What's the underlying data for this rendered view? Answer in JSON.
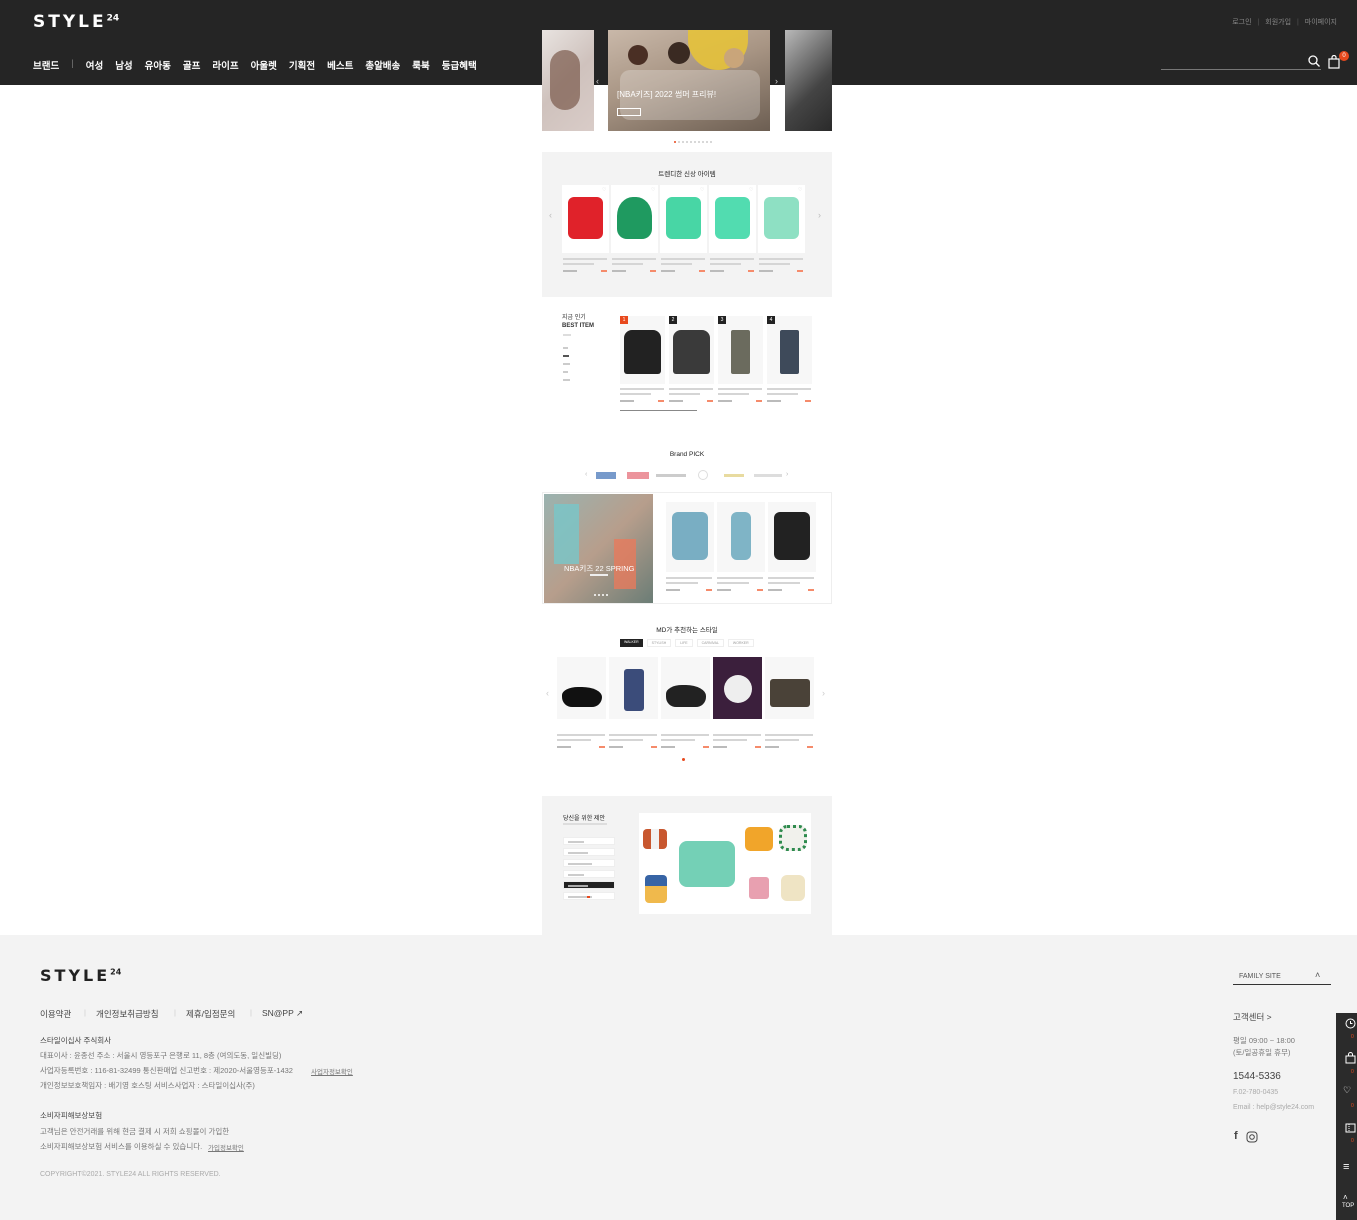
{
  "header": {
    "logo": "STYLE",
    "logo_sup": "24",
    "util_links": [
      "로그인",
      "회원가입",
      "마이페이지"
    ],
    "nav": [
      "브랜드",
      "여성",
      "남성",
      "유아동",
      "골프",
      "라이프",
      "아울렛",
      "기획전",
      "베스트",
      "총알배송",
      "룩북",
      "등급혜택"
    ],
    "cart_count": "0"
  },
  "hero": {
    "title": "[NBA키즈] 2022 썸머 프리뷰!",
    "dots_total": 10,
    "dots_active": 1
  },
  "trend": {
    "title": "트렌디한 신상 아이템",
    "items": [
      {
        "name": "red-polo",
        "color": "#e0222a"
      },
      {
        "name": "green-bucket-hat",
        "color": "#1f9a60"
      },
      {
        "name": "mint-tshirt",
        "color": "#48d6a5"
      },
      {
        "name": "mint-tshirt-2",
        "color": "#52dcb0"
      },
      {
        "name": "striped-tshirt",
        "color": "#8ee0c3"
      }
    ]
  },
  "best": {
    "title_1": "지금 인기",
    "title_2": "BEST ITEM",
    "badges": [
      "1",
      "2",
      "3",
      "4"
    ]
  },
  "brand_pick": {
    "title": "Brand PICK",
    "promo_title": "NBA키즈 22 SPRING"
  },
  "md": {
    "title": "MD가 추천하는 스타일",
    "tabs": [
      "WALKER",
      "STYLISH",
      "LIFE",
      "CARNIVAL",
      "WORKER"
    ]
  },
  "parent": {
    "title": "당신을 위한 제안"
  },
  "footer": {
    "logo": "STYLE",
    "logo_sup": "24",
    "links": [
      "이용약관",
      "개인정보취급방침",
      "제휴/입점문의",
      "SN@PP"
    ],
    "company": "스타일이십사 주식회사",
    "line1": "대표이사 : 윤종선    주소 : 서울시 영등포구 은행로 11, 8층 (여의도동, 일신빌딩)",
    "line2": "사업자등록번호 : 116-81-32499    통신판매업 신고번호 : 제2020-서울영등포-1432",
    "biz_check": "사업자정보확인",
    "line3": "개인정보보호책임자 : 배기영    호스팅 서비스사업자 : 스타일이십사(주)",
    "guarantee_title": "소비자피해보상보험",
    "guarantee_1": "고객님은 안전거래를 위해 현금 결제 시 저희 쇼핑몰이 가입한",
    "guarantee_2": "소비자피해보상보험 서비스를 이용하실 수 있습니다.",
    "guarantee_link": "가입정보확인",
    "copyright": "COPYRIGHT©2021. STYLE24 ALL RIGHTS RESERVED.",
    "family_site": "FAMILY SITE",
    "cs_title": "고객센터 >",
    "cs_hours_1": "평일 09:00 ~ 18:00",
    "cs_hours_2": "(토/일공휴일 휴무)",
    "cs_phone": "1544-5336",
    "cs_fax": "F.02-780-0435",
    "cs_email": "Email : help@style24.com"
  },
  "quickbar": {
    "recent_count": "0",
    "cart_count": "0",
    "wish_count": "0",
    "coupon_count": "0",
    "top_label": "TOP"
  }
}
